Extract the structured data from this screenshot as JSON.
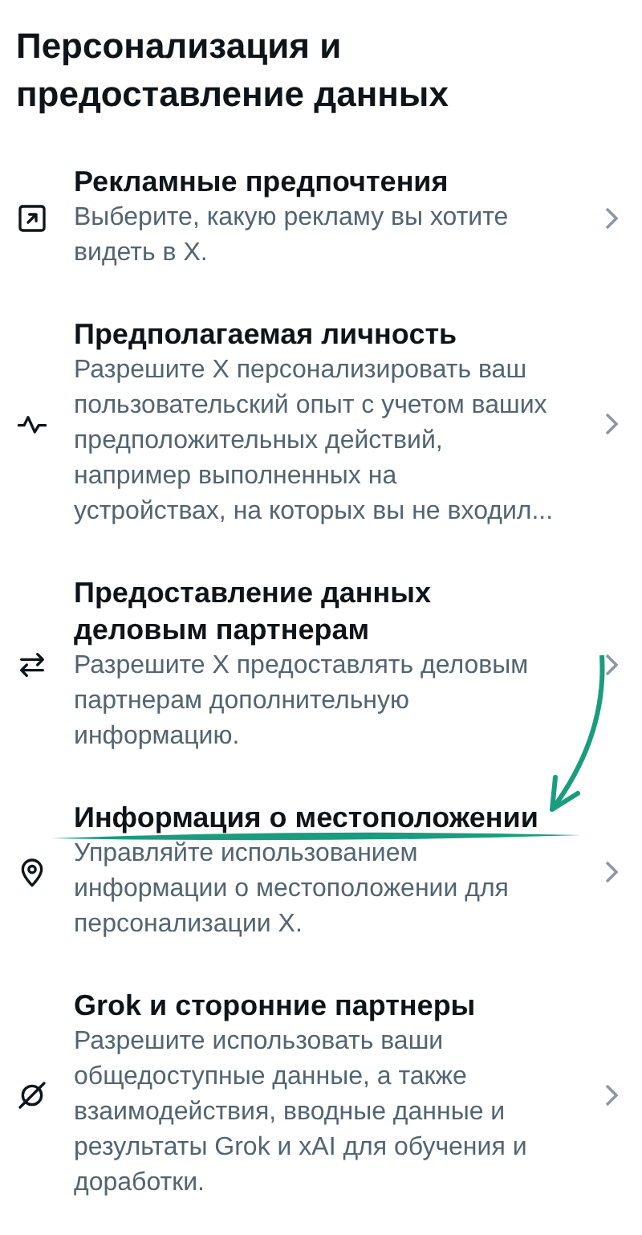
{
  "title": "Персонализация и предоставление данных",
  "items": [
    {
      "kind": "ad",
      "title": "Рекламные предпочтения",
      "description": "Выберите, какую рекламу вы хотите видеть в X.",
      "annotated": false
    },
    {
      "kind": "pulse",
      "title": "Предполагаемая личность",
      "description": "Разрешите X персонализировать ваш пользовательский опыт с учетом ваших предположительных действий, например выполненных на устройствах, на которых вы не входил...",
      "annotated": false
    },
    {
      "kind": "swap",
      "title": "Предоставление данных деловым партнерам",
      "description": "Разрешите X предоставлять деловым партнерам дополнительную информацию.",
      "annotated": false
    },
    {
      "kind": "pin",
      "title": "Информация о местоположении",
      "description": "Управляйте использованием информации о местоположении для персонализации X.",
      "annotated": true
    },
    {
      "kind": "grok",
      "title": "Grok и сторонние партнеры",
      "description": "Разрешите использовать ваши общедоступные данные, а также взаимодействия, вводные данные и результаты Grok и xAI для обучения и доработки.",
      "annotated": false
    }
  ]
}
